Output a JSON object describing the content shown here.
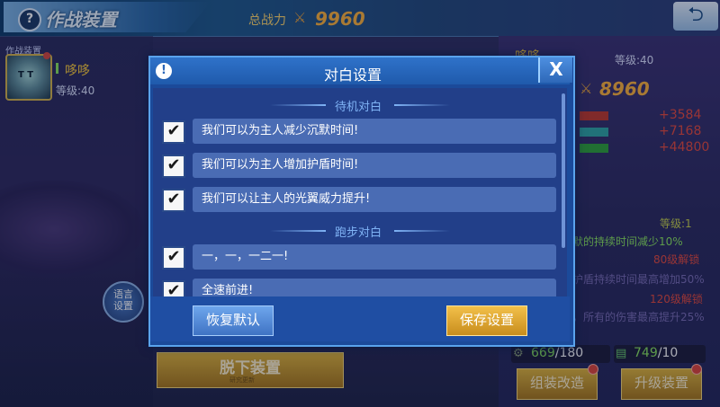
{
  "header": {
    "title": "作战装置",
    "power_label": "总战力",
    "power_value": "9960",
    "back_icon": "back-arrow-icon"
  },
  "left": {
    "equip_tag": "作战装置",
    "character_name": "哆哆",
    "character_level": "等级:40",
    "language_button": [
      "语言",
      "设置"
    ],
    "unequip_button": "脱下装置",
    "unequip_sub": "研究更新"
  },
  "right": {
    "name": "哆哆",
    "level": "等级:40",
    "power_value": "8960",
    "stats": [
      {
        "value": "+3584",
        "color": "#c0392b"
      },
      {
        "value": "+7168",
        "color": "#2fa7a5"
      },
      {
        "value": "+44800",
        "color": "#2ea33a"
      }
    ],
    "skill_level": "等级:1",
    "lines": [
      {
        "text": "默的持续时间减少10%",
        "color": "#8be65e"
      },
      {
        "text": "80级解锁",
        "color": "#e64a3c"
      },
      {
        "text": "护盾持续时间最高增加50%",
        "color": "#7a6db5"
      },
      {
        "text": "120级解锁",
        "color": "#e64a3c"
      },
      {
        "text": "，所有的伤害最高提升25%",
        "color": "#7a6db5"
      }
    ],
    "resource1": {
      "have": "669",
      "need": "/180"
    },
    "resource2": {
      "have": "749",
      "need": "/10"
    },
    "assemble_button": "组装改造",
    "upgrade_button": "升级装置"
  },
  "dialog": {
    "title": "对白设置",
    "close_label": "X",
    "sections": [
      {
        "title": "待机对白",
        "items": [
          {
            "text": "我们可以为主人减少沉默时间!",
            "checked": true
          },
          {
            "text": "我们可以为主人增加护盾时间!",
            "checked": true
          },
          {
            "text": "我们可以让主人的光翼威力提升!",
            "checked": true
          }
        ]
      },
      {
        "title": "跑步对白",
        "items": [
          {
            "text": "一，一，一二一!",
            "checked": true
          },
          {
            "text": "全速前进!",
            "checked": true
          }
        ]
      }
    ],
    "reset_button": "恢复默认",
    "save_button": "保存设置"
  },
  "colors": {
    "accent": "#ffb43a",
    "dialog_bg": "#1b4a9a",
    "row_bg": "#4a6cb4"
  }
}
